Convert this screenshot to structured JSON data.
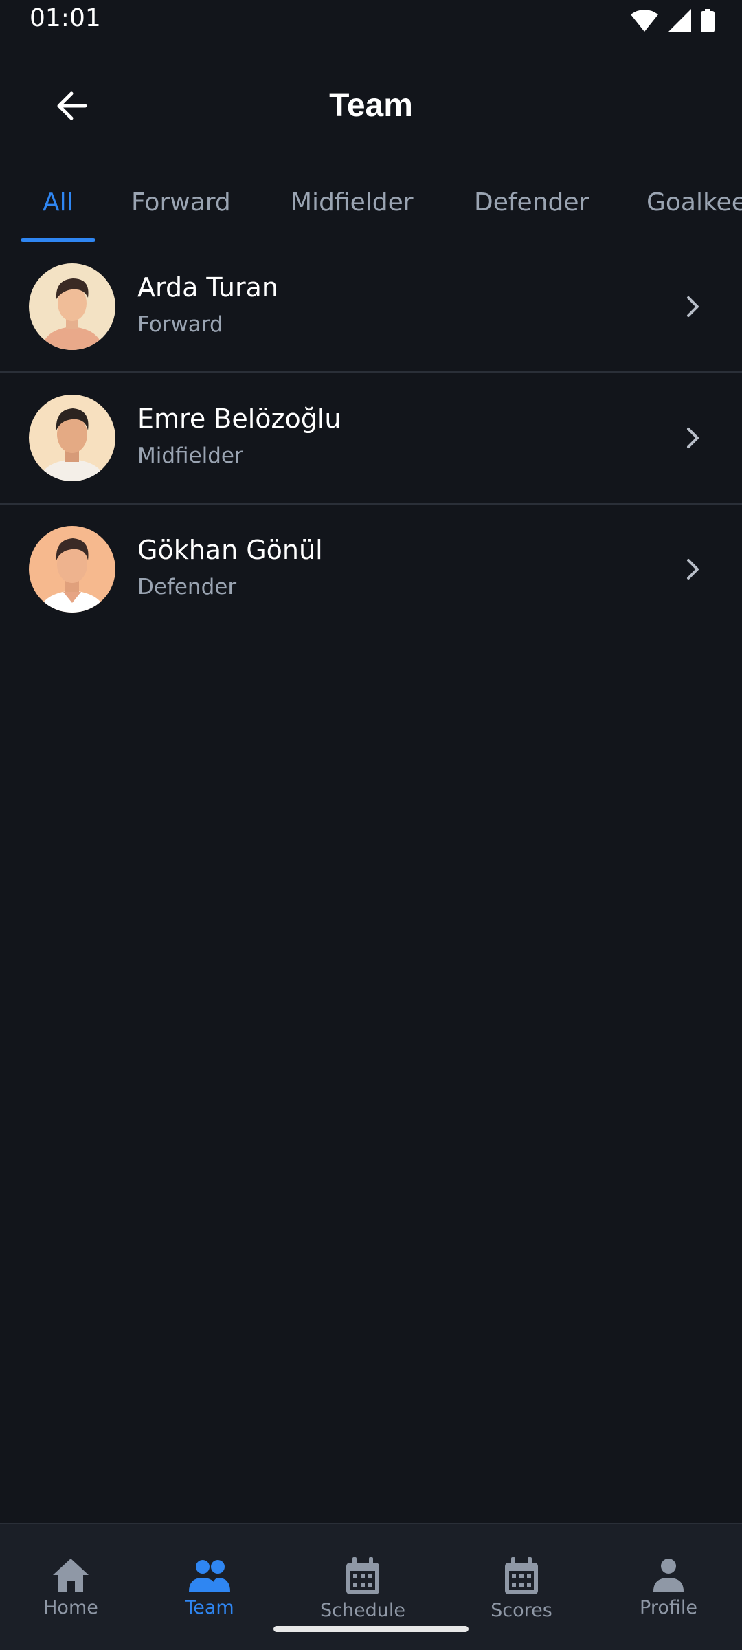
{
  "status_bar": {
    "time": "01:01"
  },
  "header": {
    "title": "Team",
    "back_icon": "arrow-left-icon"
  },
  "tabs": [
    {
      "label": "All",
      "active": true
    },
    {
      "label": "Forward",
      "active": false
    },
    {
      "label": "Midfielder",
      "active": false
    },
    {
      "label": "Defender",
      "active": false
    },
    {
      "label": "Goalkeeper",
      "active": false
    }
  ],
  "players": [
    {
      "name": "Arda Turan",
      "position": "Forward",
      "avatar_bg": "#f3e2c4"
    },
    {
      "name": "Emre Belözoğlu",
      "position": "Midfielder",
      "avatar_bg": "#f7e0bf"
    },
    {
      "name": "Gökhan Gönül",
      "position": "Defender",
      "avatar_bg": "#f6b98e"
    }
  ],
  "bottom_nav": [
    {
      "label": "Home",
      "icon": "home-icon",
      "active": false
    },
    {
      "label": "Team",
      "icon": "people-icon",
      "active": true
    },
    {
      "label": "Schedule",
      "icon": "calendar-icon",
      "active": false
    },
    {
      "label": "Scores",
      "icon": "calendar-icon",
      "active": false
    },
    {
      "label": "Profile",
      "icon": "person-icon",
      "active": false
    }
  ],
  "colors": {
    "background": "#12151b",
    "accent": "#2f86f2",
    "muted_text": "#9aa4b2",
    "nav_background": "#1b1f27"
  }
}
